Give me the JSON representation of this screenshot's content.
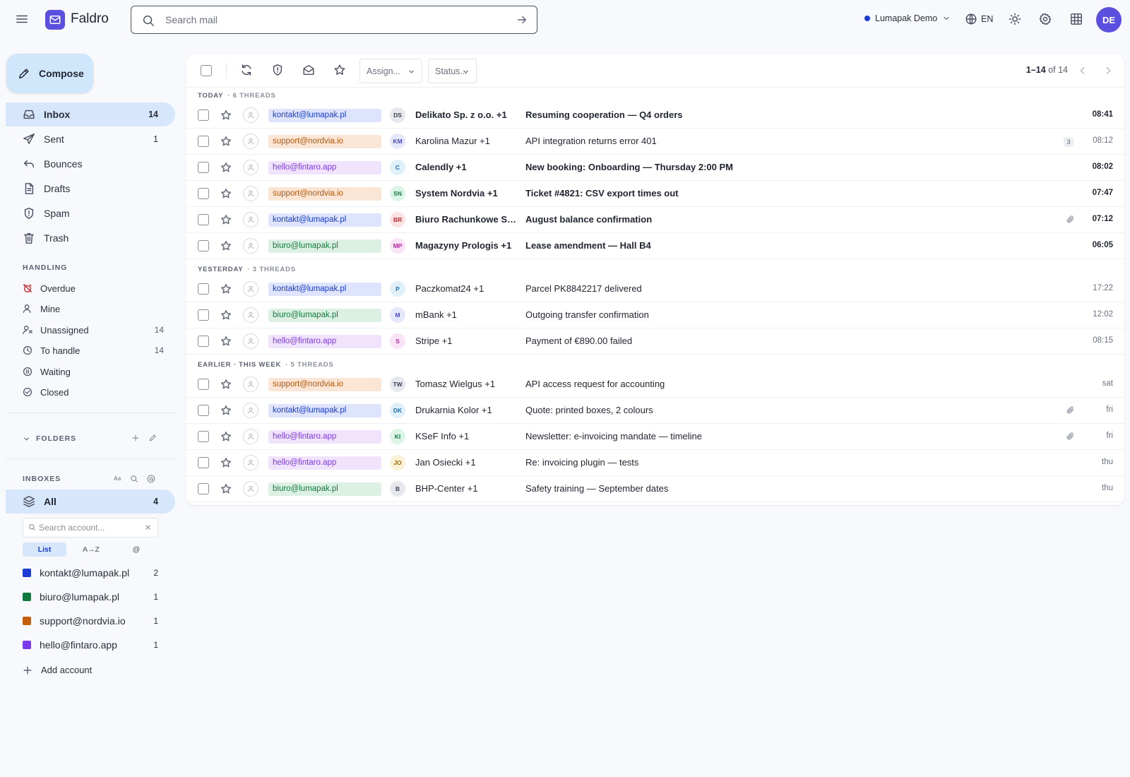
{
  "app": {
    "name": "Faldro",
    "org": "Lumapak Demo",
    "lang": "EN",
    "user_initials": "DE"
  },
  "search": {
    "placeholder": "Search mail"
  },
  "compose_label": "Compose",
  "nav": [
    {
      "label": "Inbox",
      "count": "14",
      "icon": "inbox-icon"
    },
    {
      "label": "Sent",
      "count": "1",
      "icon": "send-icon"
    },
    {
      "label": "Bounces",
      "count": "",
      "icon": "bounce-icon"
    },
    {
      "label": "Drafts",
      "count": "",
      "icon": "draft-icon"
    },
    {
      "label": "Spam",
      "count": "",
      "icon": "shield-icon"
    },
    {
      "label": "Trash",
      "count": "",
      "icon": "trash-icon"
    }
  ],
  "handling": {
    "title": "HANDLING",
    "items": [
      {
        "label": "Overdue",
        "count": "",
        "icon": "alarm-off-icon"
      },
      {
        "label": "Mine",
        "count": "",
        "icon": "user-icon"
      },
      {
        "label": "Unassigned",
        "count": "14",
        "icon": "user-x-icon"
      },
      {
        "label": "To handle",
        "count": "14",
        "icon": "clock-icon"
      },
      {
        "label": "Waiting",
        "count": "",
        "icon": "pause-icon"
      },
      {
        "label": "Closed",
        "count": "",
        "icon": "check-circle-icon"
      }
    ]
  },
  "folders": {
    "title": "FOLDERS"
  },
  "inboxes": {
    "title": "INBOXES",
    "all_label": "All",
    "all_count": "4",
    "search_placeholder": "Search account...",
    "view_modes": [
      "List",
      "A→Z",
      "@"
    ],
    "accounts": [
      {
        "email": "kontakt@lumapak.pl",
        "count": "2",
        "color": "#1a3cd0"
      },
      {
        "email": "biuro@lumapak.pl",
        "count": "1",
        "color": "#137a3f"
      },
      {
        "email": "support@nordvia.io",
        "count": "1",
        "color": "#c25e0c"
      },
      {
        "email": "hello@fintaro.app",
        "count": "1",
        "color": "#7c3aed"
      }
    ],
    "add_label": "Add account"
  },
  "toolbar": {
    "assign_label": "Assign...",
    "status_label": "Status...",
    "range": "1–14",
    "of_label": "of 14"
  },
  "groups": [
    {
      "title": "TODAY",
      "sub": "· 6 THREADS"
    },
    {
      "title": "YESTERDAY",
      "sub": "· 3 THREADS"
    },
    {
      "title": "EARLIER · THIS WEEK",
      "sub": "· 5 THREADS"
    }
  ],
  "tag_styles": {
    "kontakt@lumapak.pl": {
      "bg": "#dde4fb",
      "fg": "#1a3cd0"
    },
    "support@nordvia.io": {
      "bg": "#fbe6d6",
      "fg": "#b4560c"
    },
    "hello@fintaro.app": {
      "bg": "#f0e3fb",
      "fg": "#7c3aed"
    },
    "biuro@lumapak.pl": {
      "bg": "#dcf1e4",
      "fg": "#137a3f"
    }
  },
  "emails": [
    {
      "account": "kontakt@lumapak.pl",
      "initials": "DS",
      "sender": "Delikato Sp. z o.o. +1",
      "subject": "Resuming cooperation — Q4 orders",
      "time": "08:41",
      "unread": true,
      "attachment": false,
      "thread_count": "",
      "av_bg": "#e6e8ee",
      "av_fg": "#3a4050"
    },
    {
      "account": "support@nordvia.io",
      "initials": "KM",
      "sender": "Karolina Mazur +1",
      "subject": "API integration returns error 401",
      "time": "08:12",
      "unread": false,
      "attachment": false,
      "thread_count": "3",
      "av_bg": "#e5e7fb",
      "av_fg": "#4a48c8"
    },
    {
      "account": "hello@fintaro.app",
      "initials": "C",
      "sender": "Calendly +1",
      "subject": "New booking: Onboarding — Thursday 2:00 PM",
      "time": "08:02",
      "unread": true,
      "attachment": false,
      "thread_count": "",
      "av_bg": "#dff0fb",
      "av_fg": "#1f6fb0"
    },
    {
      "account": "support@nordvia.io",
      "initials": "SN",
      "sender": "System Nordvia +1",
      "subject": "Ticket #4821: CSV export times out",
      "time": "07:47",
      "unread": true,
      "attachment": false,
      "thread_count": "",
      "av_bg": "#dcf5e6",
      "av_fg": "#137a3f"
    },
    {
      "account": "kontakt@lumapak.pl",
      "initials": "BR",
      "sender": "Biuro Rachunkowe Saldo +1",
      "subject": "August balance confirmation",
      "time": "07:12",
      "unread": true,
      "attachment": true,
      "thread_count": "",
      "av_bg": "#fbe3e3",
      "av_fg": "#c0262d"
    },
    {
      "account": "biuro@lumapak.pl",
      "initials": "MP",
      "sender": "Magazyny Prologis +1",
      "subject": "Lease amendment — Hall B4",
      "time": "06:05",
      "unread": true,
      "attachment": false,
      "thread_count": "",
      "av_bg": "#fae3f6",
      "av_fg": "#b02a9a"
    },
    {
      "account": "kontakt@lumapak.pl",
      "initials": "P",
      "sender": "Paczkomat24 +1",
      "subject": "Parcel PK8842217 delivered",
      "time": "17:22",
      "unread": false,
      "attachment": false,
      "thread_count": "",
      "av_bg": "#dff0fb",
      "av_fg": "#1f6fb0"
    },
    {
      "account": "biuro@lumapak.pl",
      "initials": "M",
      "sender": "mBank +1",
      "subject": "Outgoing transfer confirmation",
      "time": "12:02",
      "unread": false,
      "attachment": false,
      "thread_count": "",
      "av_bg": "#e5e7fb",
      "av_fg": "#4a48c8"
    },
    {
      "account": "hello@fintaro.app",
      "initials": "S",
      "sender": "Stripe +1",
      "subject": "Payment of €890.00 failed",
      "time": "08:15",
      "unread": false,
      "attachment": false,
      "thread_count": "",
      "av_bg": "#fae3f6",
      "av_fg": "#b02a9a"
    },
    {
      "account": "support@nordvia.io",
      "initials": "TW",
      "sender": "Tomasz Wielgus +1",
      "subject": "API access request for accounting",
      "time": "sat",
      "unread": false,
      "attachment": false,
      "thread_count": "",
      "av_bg": "#e6e8ee",
      "av_fg": "#3a4050"
    },
    {
      "account": "kontakt@lumapak.pl",
      "initials": "DK",
      "sender": "Drukarnia Kolor +1",
      "subject": "Quote: printed boxes, 2 colours",
      "time": "fri",
      "unread": false,
      "attachment": true,
      "thread_count": "",
      "av_bg": "#dff0fb",
      "av_fg": "#1f6fb0"
    },
    {
      "account": "hello@fintaro.app",
      "initials": "KI",
      "sender": "KSeF Info +1",
      "subject": "Newsletter: e-invoicing mandate — timeline",
      "time": "fri",
      "unread": false,
      "attachment": true,
      "thread_count": "",
      "av_bg": "#dcf5e6",
      "av_fg": "#137a3f"
    },
    {
      "account": "hello@fintaro.app",
      "initials": "JO",
      "sender": "Jan Osiecki +1",
      "subject": "Re: invoicing plugin — tests",
      "time": "thu",
      "unread": false,
      "attachment": false,
      "thread_count": "",
      "av_bg": "#fbf1d6",
      "av_fg": "#a06a00"
    },
    {
      "account": "biuro@lumapak.pl",
      "initials": "B",
      "sender": "BHP-Center +1",
      "subject": "Safety training — September dates",
      "time": "thu",
      "unread": false,
      "attachment": false,
      "thread_count": "",
      "av_bg": "#e6e8ee",
      "av_fg": "#3a4050"
    }
  ]
}
